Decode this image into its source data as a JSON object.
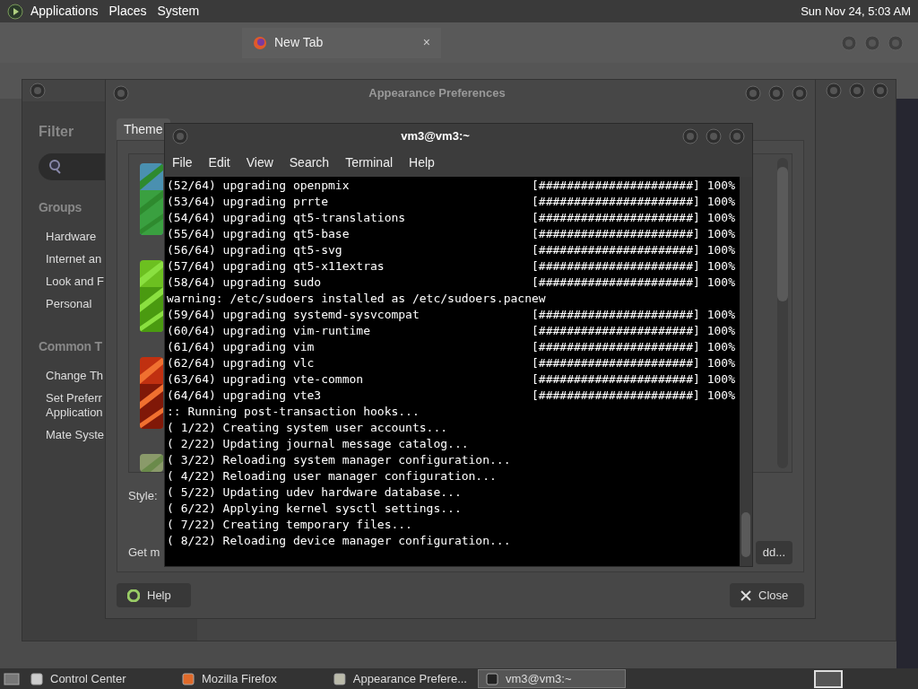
{
  "top_panel": {
    "menus": [
      "Applications",
      "Places",
      "System"
    ],
    "clock": "Sun Nov 24, 5:03 AM"
  },
  "browser": {
    "tab": {
      "label": "New Tab",
      "close": "×"
    }
  },
  "control_center": {
    "filter_label": "Filter",
    "sections": [
      {
        "title": "Groups",
        "items": [
          "Hardware",
          "Internet an",
          "Look and F",
          "Personal"
        ]
      },
      {
        "title": "Common T",
        "items": [
          "Change Th",
          "Set Preferr\nApplication",
          "Mate Syste"
        ]
      }
    ]
  },
  "appearance": {
    "title": "Appearance Preferences",
    "tab": "Theme",
    "style_label": "Style:",
    "get_more": "Get m",
    "add_button": "dd...",
    "help_button": "Help",
    "close_button": "Close"
  },
  "terminal": {
    "title": "vm3@vm3:~",
    "menus": [
      "File",
      "Edit",
      "View",
      "Search",
      "Terminal",
      "Help"
    ],
    "lines": [
      {
        "text": "(52/64) upgrading openpmix",
        "bar": "[######################] 100%"
      },
      {
        "text": "(53/64) upgrading prrte",
        "bar": "[######################] 100%"
      },
      {
        "text": "(54/64) upgrading qt5-translations",
        "bar": "[######################] 100%"
      },
      {
        "text": "(55/64) upgrading qt5-base",
        "bar": "[######################] 100%"
      },
      {
        "text": "(56/64) upgrading qt5-svg",
        "bar": "[######################] 100%"
      },
      {
        "text": "(57/64) upgrading qt5-x11extras",
        "bar": "[######################] 100%"
      },
      {
        "text": "(58/64) upgrading sudo",
        "bar": "[######################] 100%"
      },
      {
        "text": "warning: /etc/sudoers installed as /etc/sudoers.pacnew"
      },
      {
        "text": "(59/64) upgrading systemd-sysvcompat",
        "bar": "[######################] 100%"
      },
      {
        "text": "(60/64) upgrading vim-runtime",
        "bar": "[######################] 100%"
      },
      {
        "text": "(61/64) upgrading vim",
        "bar": "[######################] 100%"
      },
      {
        "text": "(62/64) upgrading vlc",
        "bar": "[######################] 100%"
      },
      {
        "text": "(63/64) upgrading vte-common",
        "bar": "[######################] 100%"
      },
      {
        "text": "(64/64) upgrading vte3",
        "bar": "[######################] 100%"
      },
      {
        "text": ":: Running post-transaction hooks..."
      },
      {
        "text": "( 1/22) Creating system user accounts..."
      },
      {
        "text": "( 2/22) Updating journal message catalog..."
      },
      {
        "text": "( 3/22) Reloading system manager configuration..."
      },
      {
        "text": "( 4/22) Reloading user manager configuration..."
      },
      {
        "text": "( 5/22) Updating udev hardware database..."
      },
      {
        "text": "( 6/22) Applying kernel sysctl settings..."
      },
      {
        "text": "( 7/22) Creating temporary files..."
      },
      {
        "text": "( 8/22) Reloading device manager configuration..."
      }
    ]
  },
  "taskbar": [
    {
      "label": "Control Center",
      "selected": false
    },
    {
      "label": "Mozilla Firefox",
      "selected": false
    },
    {
      "label": "Appearance Prefere...",
      "selected": false
    },
    {
      "label": "vm3@vm3:~",
      "selected": true
    }
  ]
}
